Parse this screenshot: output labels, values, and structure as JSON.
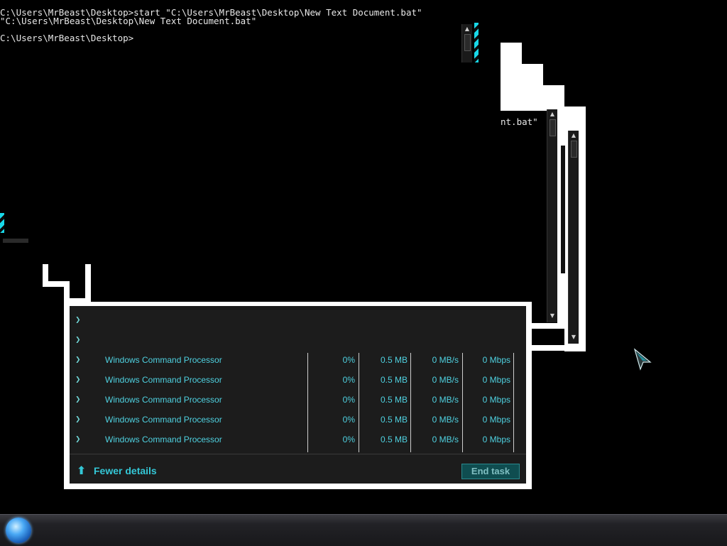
{
  "console": {
    "lines": [
      "C:\\Users\\MrBeast\\Desktop>start \"C:\\Users\\MrBeast\\Desktop\\New Text Document.bat\"",
      "\"C:\\Users\\MrBeast\\Desktop\\New Text Document.bat\"",
      "",
      "C:\\Users\\MrBeast\\Desktop>"
    ],
    "fragment": "nt.bat\""
  },
  "task_manager": {
    "rows": [
      {
        "name": "Windows Command Processor",
        "cpu": "0%",
        "memory": "0.5 MB",
        "disk": "0 MB/s",
        "network": "0 Mbps"
      },
      {
        "name": "Windows Command Processor",
        "cpu": "0%",
        "memory": "0.5 MB",
        "disk": "0 MB/s",
        "network": "0 Mbps"
      },
      {
        "name": "Windows Command Processor",
        "cpu": "0%",
        "memory": "0.5 MB",
        "disk": "0 MB/s",
        "network": "0 Mbps"
      },
      {
        "name": "Windows Command Processor",
        "cpu": "0%",
        "memory": "0.5 MB",
        "disk": "0 MB/s",
        "network": "0 Mbps"
      },
      {
        "name": "Windows Command Processor",
        "cpu": "0%",
        "memory": "0.5 MB",
        "disk": "0 MB/s",
        "network": "0 Mbps"
      }
    ],
    "fewer_details": "Fewer details",
    "end_task": "End task"
  },
  "icons": {
    "chevron": "chevron-right-icon",
    "fewer": "arrow-up-icon",
    "start": "start-orb-icon",
    "cursor": "mouse-pointer-icon"
  },
  "colors": {
    "accent": "#4fd1e0",
    "end_task_bg": "#0f4d50"
  }
}
